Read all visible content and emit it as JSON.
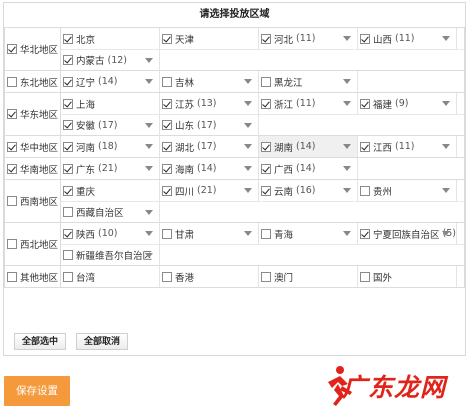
{
  "title": "请选择投放区域",
  "regions": [
    {
      "label": "华北地区",
      "checked": true,
      "lines": [
        [
          {
            "name": "北京",
            "count": "",
            "checked": true,
            "arrow": false
          },
          {
            "name": "天津",
            "count": "",
            "checked": true,
            "arrow": false
          },
          {
            "name": "河北",
            "count": "(11)",
            "checked": true,
            "arrow": true
          },
          {
            "name": "山西",
            "count": "(11)",
            "checked": true,
            "arrow": true
          }
        ],
        [
          {
            "name": "内蒙古",
            "count": "(12)",
            "checked": true,
            "arrow": true
          }
        ]
      ]
    },
    {
      "label": "东北地区",
      "checked": false,
      "lines": [
        [
          {
            "name": "辽宁",
            "count": "(14)",
            "checked": true,
            "arrow": true
          },
          {
            "name": "吉林",
            "count": "",
            "checked": false,
            "arrow": true
          },
          {
            "name": "黑龙江",
            "count": "",
            "checked": false,
            "arrow": true
          }
        ]
      ]
    },
    {
      "label": "华东地区",
      "checked": true,
      "lines": [
        [
          {
            "name": "上海",
            "count": "",
            "checked": true,
            "arrow": false
          },
          {
            "name": "江苏",
            "count": "(13)",
            "checked": true,
            "arrow": true
          },
          {
            "name": "浙江",
            "count": "(11)",
            "checked": true,
            "arrow": true
          },
          {
            "name": "福建",
            "count": "(9)",
            "checked": true,
            "arrow": true
          }
        ],
        [
          {
            "name": "安徽",
            "count": "(17)",
            "checked": true,
            "arrow": true
          },
          {
            "name": "山东",
            "count": "(17)",
            "checked": true,
            "arrow": true
          }
        ]
      ]
    },
    {
      "label": "华中地区",
      "checked": true,
      "lines": [
        [
          {
            "name": "河南",
            "count": "(18)",
            "checked": true,
            "arrow": true
          },
          {
            "name": "湖北",
            "count": "(17)",
            "checked": true,
            "arrow": true
          },
          {
            "name": "湖南",
            "count": "(14)",
            "checked": true,
            "arrow": true,
            "highlight": true
          },
          {
            "name": "江西",
            "count": "(11)",
            "checked": true,
            "arrow": true
          }
        ]
      ]
    },
    {
      "label": "华南地区",
      "checked": true,
      "lines": [
        [
          {
            "name": "广东",
            "count": "(21)",
            "checked": true,
            "arrow": true
          },
          {
            "name": "海南",
            "count": "(14)",
            "checked": true,
            "arrow": true
          },
          {
            "name": "广西",
            "count": "(14)",
            "checked": true,
            "arrow": true
          }
        ]
      ]
    },
    {
      "label": "西南地区",
      "checked": false,
      "lines": [
        [
          {
            "name": "重庆",
            "count": "",
            "checked": true,
            "arrow": false
          },
          {
            "name": "四川",
            "count": "(21)",
            "checked": true,
            "arrow": true
          },
          {
            "name": "云南",
            "count": "(16)",
            "checked": true,
            "arrow": true
          },
          {
            "name": "贵州",
            "count": "",
            "checked": false,
            "arrow": true
          }
        ],
        [
          {
            "name": "西藏自治区",
            "count": "",
            "checked": false,
            "arrow": true
          }
        ]
      ]
    },
    {
      "label": "西北地区",
      "checked": false,
      "lines": [
        [
          {
            "name": "陕西",
            "count": "(10)",
            "checked": true,
            "arrow": true
          },
          {
            "name": "甘肃",
            "count": "",
            "checked": false,
            "arrow": true
          },
          {
            "name": "青海",
            "count": "",
            "checked": false,
            "arrow": true
          },
          {
            "name": "宁夏回族自治区",
            "count": "(5)",
            "checked": true,
            "arrow": true
          }
        ],
        [
          {
            "name": "新疆维吾尔自治区",
            "count": "",
            "checked": false,
            "arrow": true
          }
        ]
      ]
    },
    {
      "label": "其他地区",
      "checked": false,
      "lines": [
        [
          {
            "name": "台湾",
            "count": "",
            "checked": false,
            "arrow": false
          },
          {
            "name": "香港",
            "count": "",
            "checked": false,
            "arrow": false
          },
          {
            "name": "澳门",
            "count": "",
            "checked": false,
            "arrow": false
          },
          {
            "name": "国外",
            "count": "",
            "checked": false,
            "arrow": false
          }
        ]
      ]
    }
  ],
  "select_all_label": "全部选中",
  "deselect_all_label": "全部取消",
  "save_label": "保存设置",
  "watermark_text": "广东龙网",
  "colors": {
    "save_button": "#f59a3c",
    "watermark": "#e2231a",
    "highlight_row": "#f0f0f0"
  }
}
